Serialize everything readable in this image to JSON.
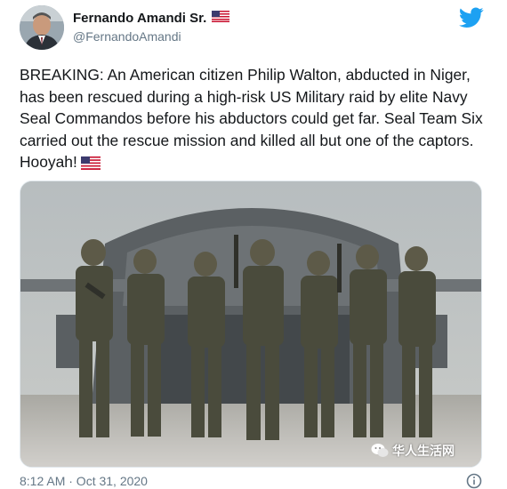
{
  "user": {
    "display_name": "Fernando Amandi Sr.",
    "handle": "@FernandoAmandi",
    "avatar_icon": "profile-photo",
    "name_flag_icon": "us-flag-emoji"
  },
  "brand": {
    "logo_icon": "twitter-bird-icon",
    "accent_color": "#1da1f2"
  },
  "tweet": {
    "text": "BREAKING: An American citizen Philip Walton, abducted in Niger, has been rescued during a high-risk US Military raid by elite Navy Seal Commandos before his abductors could get far. Seal Team Six carried out the rescue mission and killed all but one of the captors. Hooyah!",
    "trailing_emoji_icon": "us-flag-emoji"
  },
  "media": {
    "description_icon": "photo-soldiers-helicopter",
    "watermark_text": "华人生活网",
    "watermark_icon": "wechat-icon"
  },
  "footer": {
    "timestamp": "8:12 AM · Oct 31, 2020",
    "info_icon": "info-icon"
  }
}
